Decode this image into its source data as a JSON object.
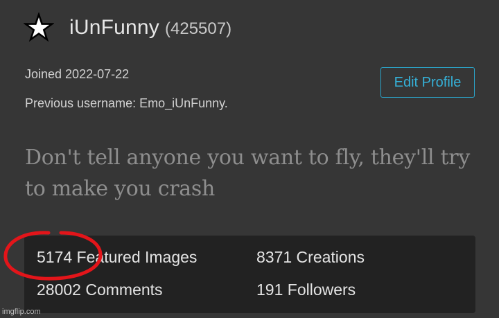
{
  "profile": {
    "username": "iUnFunny",
    "points": "(425507)",
    "joined": "Joined 2022-07-22",
    "previous_username": "Previous username: Emo_iUnFunny.",
    "edit_button": "Edit Profile",
    "bio": "Don't tell anyone you want to fly, they'll try to make you crash"
  },
  "stats": {
    "featured": "5174 Featured Images",
    "creations": "8371 Creations",
    "comments": "28002 Comments",
    "followers": "191 Followers"
  },
  "watermark": "imgflip.com",
  "colors": {
    "background": "#363636",
    "accent": "#35b1d8",
    "stats_panel": "#222222",
    "annotation": "#e3151a"
  },
  "icons": {
    "avatar": "star-icon"
  }
}
